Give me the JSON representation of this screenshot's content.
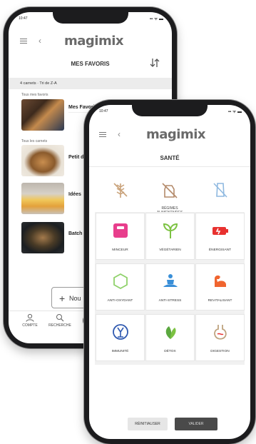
{
  "back_screen": {
    "brand": "magimix",
    "title": "MES FAVORIS",
    "filter_text": "4 carnets · Tri de Z-A",
    "section_all": "Tous mes favoris",
    "section_carnets": "Tous les carnets",
    "items": [
      {
        "label": "Mes Favoris"
      },
      {
        "label": "Petit d"
      },
      {
        "label": "Idées"
      },
      {
        "label": "Batch"
      }
    ],
    "add_button": "Nou",
    "tabs": [
      {
        "label": "COMPTE"
      },
      {
        "label": "RECHERCHE"
      }
    ]
  },
  "front_screen": {
    "brand": "magimix",
    "title": "SANTÉ",
    "diet_section": "RÉGIMES ALIMENTAIRES",
    "diet_icons": [
      "no-gluten-icon",
      "no-lactose-icon",
      "no-sugar-icon"
    ],
    "tiles": [
      {
        "label": "MINCEUR",
        "icon": "scale-icon",
        "color": "#e83e8c"
      },
      {
        "label": "VÉGÉTARIEN",
        "icon": "sprout-icon",
        "color": "#7cc242"
      },
      {
        "label": "ÉNERGISANT",
        "icon": "battery-icon",
        "color": "#e8312f"
      },
      {
        "label": "ANTI-OXYDANT",
        "icon": "hexagon-icon",
        "color": "#8fd16a"
      },
      {
        "label": "ANTI-STRESS",
        "icon": "meditation-icon",
        "color": "#3a8fd8"
      },
      {
        "label": "REVITALISANT",
        "icon": "muscle-icon",
        "color": "#f0652f"
      },
      {
        "label": "IMMUNITÉ",
        "icon": "immunity-icon",
        "color": "#2f59b0"
      },
      {
        "label": "DÉTOX",
        "icon": "leaves-icon",
        "color": "#5ba83f"
      },
      {
        "label": "DIGESTION",
        "icon": "digestion-icon",
        "color": "#bfa480"
      }
    ],
    "reset_button": "RÉINITIALISER",
    "validate_button": "VALIDER"
  }
}
